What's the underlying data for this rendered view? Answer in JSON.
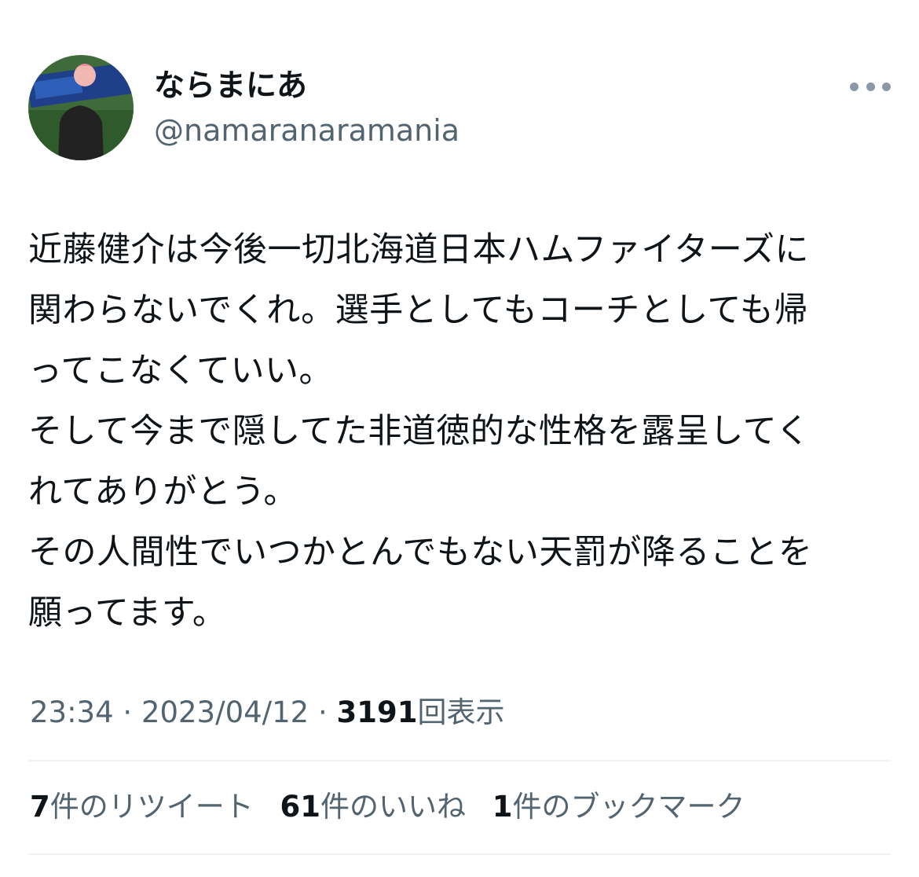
{
  "user": {
    "display_name": "ならまにあ",
    "handle": "@namaranaramania",
    "avatar_icon": "profile-photo"
  },
  "more_icon": "ellipsis-icon",
  "tweet": {
    "lines": [
      "近藤健介は今後一切北海道日本ハムファイターズに",
      "関わらないでくれ。選手としてもコーチとしても帰",
      "ってこなくていい。",
      "そして今まで隠してた非道徳的な性格を露呈してく",
      "れてありがとう。",
      "その人間性でいつかとんでもない天罰が降ることを",
      "願ってます。"
    ]
  },
  "meta": {
    "time": "23:34",
    "sep1": " · ",
    "date": "2023/04/12",
    "sep2": " · ",
    "views_count": "3191",
    "views_label": "回表示"
  },
  "stats": {
    "retweets_count": "7",
    "retweets_label": "件のリツイート",
    "likes_count": "61",
    "likes_label": "件のいいね",
    "bookmarks_count": "1",
    "bookmarks_label": "件のブックマーク"
  },
  "colors": {
    "text_primary": "#0f1419",
    "text_secondary": "#536471",
    "divider": "#eff3f4"
  }
}
